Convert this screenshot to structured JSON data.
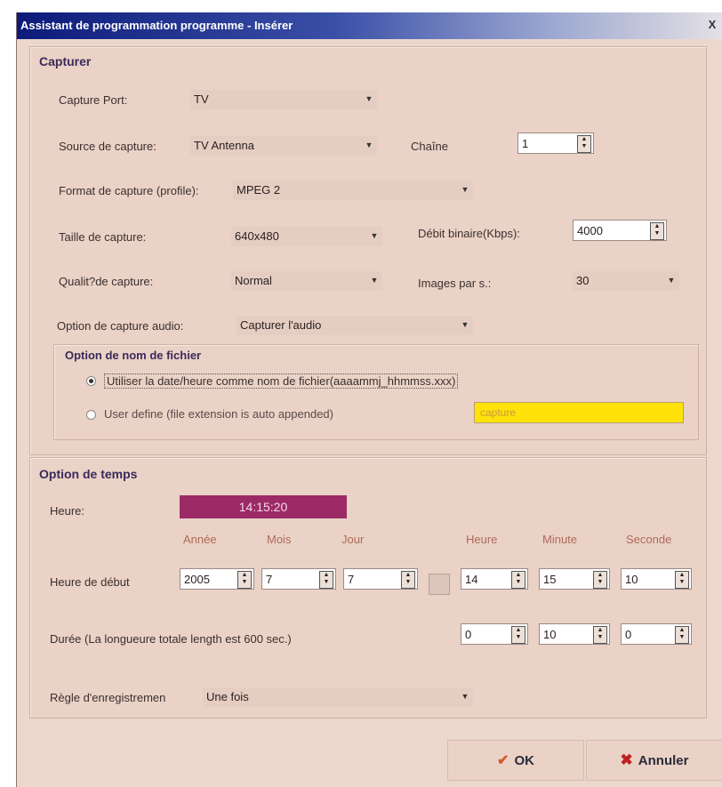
{
  "window": {
    "title": "Assistant de programmation programme - Insérer",
    "close": "X"
  },
  "capture": {
    "section_title": "Capturer",
    "port_label": "Capture Port:",
    "port_value": "TV",
    "source_label": "Source de capture:",
    "source_value": "TV Antenna",
    "channel_label": "Chaîne",
    "channel_value": "1",
    "format_label": "Format de capture (profile):",
    "format_value": "MPEG 2",
    "size_label": "Taille de capture:",
    "size_value": "640x480",
    "bitrate_label": "Débit binaire(Kbps):",
    "bitrate_value": "4000",
    "quality_label": "Qualit?de capture:",
    "quality_value": "Normal",
    "fps_label": "Images par s.:",
    "fps_value": "30",
    "audio_label": "Option de capture audio:",
    "audio_value": "Capturer l'audio"
  },
  "filename": {
    "section_title": "Option de nom de fichier",
    "option_date": "Utiliser la date/heure comme nom de fichier(aaaammj_hhmmss.xxx)",
    "option_user": "User define (file extension is auto appended)",
    "user_value": "capture"
  },
  "time": {
    "section_title": "Option de temps",
    "heure_label": "Heure:",
    "heure_value": "14:15:20",
    "col_year": "Année",
    "col_month": "Mois",
    "col_day": "Jour",
    "col_hour": "Heure",
    "col_minute": "Minute",
    "col_second": "Seconde",
    "start_label": "Heure de début",
    "start_year": "2005",
    "start_month": "7",
    "start_day": "7",
    "start_hour": "14",
    "start_minute": "15",
    "start_second": "10",
    "duration_label": "Durée (La longueure totale length est 600 sec.)",
    "dur_hour": "0",
    "dur_minute": "10",
    "dur_second": "0",
    "rule_label": "Règle d'enregistremen",
    "rule_value": "Une fois"
  },
  "buttons": {
    "ok": "OK",
    "cancel": "Annuler"
  },
  "colors": {
    "heure_bg": "#9c2a66",
    "user_field_bg": "#ffe20a",
    "window_bg": "#ecd7cc"
  }
}
